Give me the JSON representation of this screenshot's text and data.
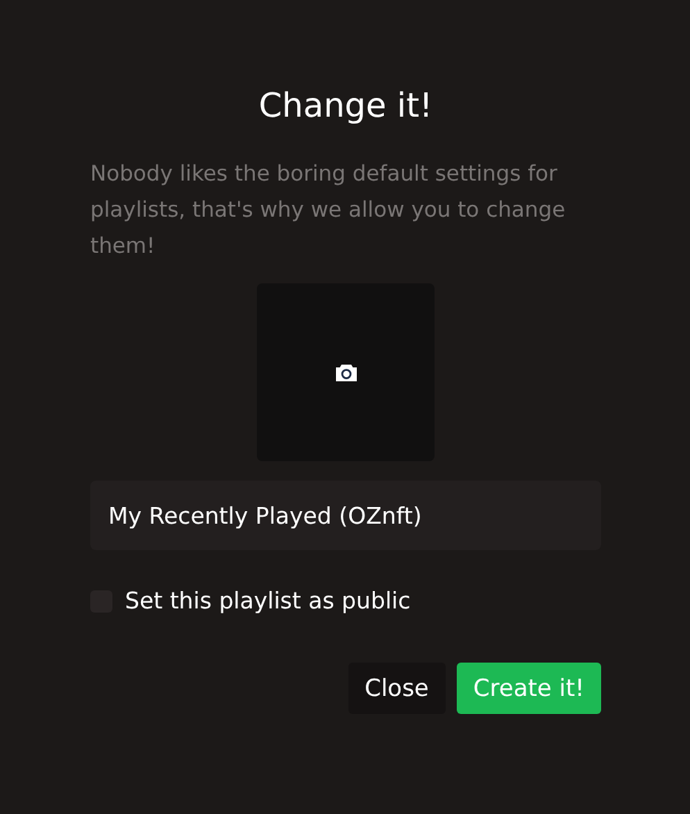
{
  "dialog": {
    "title": "Change it!",
    "description": "Nobody likes the boring default settings for playlists, that's why we allow you to change them!",
    "name_field": {
      "value": "My Recently Played (OZnft)"
    },
    "public_checkbox": {
      "label": "Set this playlist as public",
      "checked": false
    },
    "buttons": [
      {
        "label": "Close",
        "kind": "secondary"
      },
      {
        "label": "Create it!",
        "kind": "primary"
      }
    ]
  }
}
